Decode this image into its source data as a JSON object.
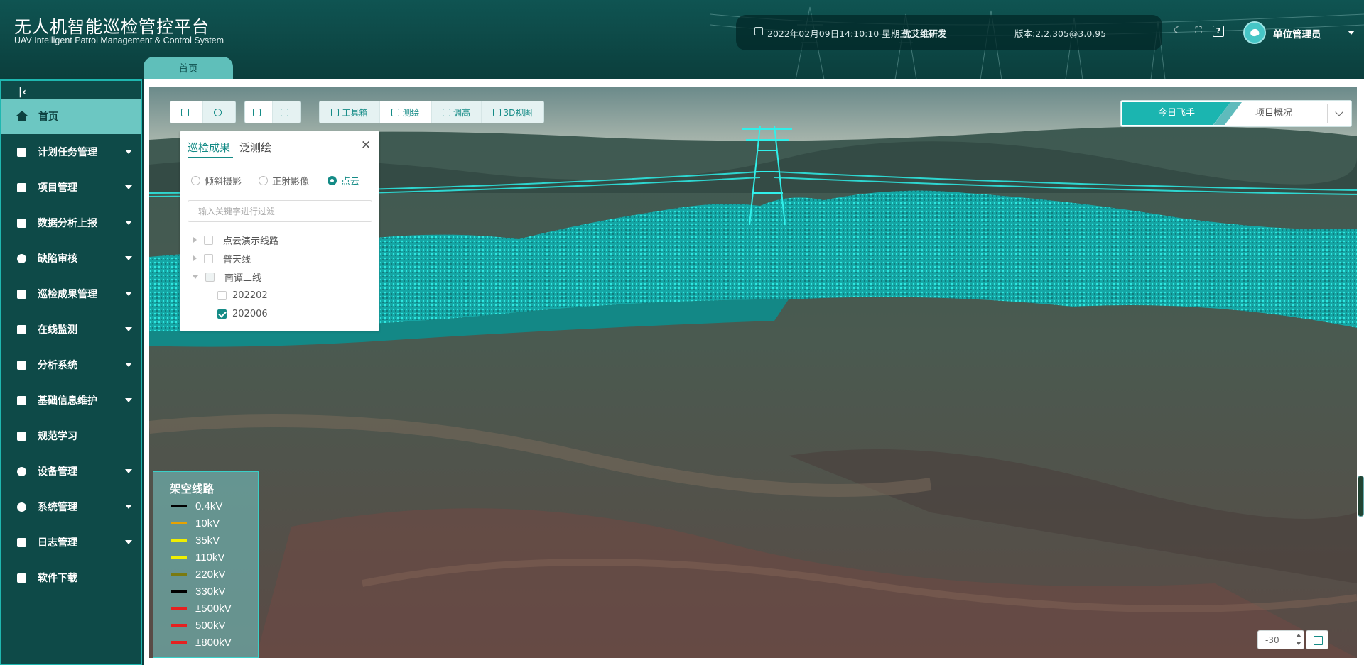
{
  "header": {
    "title": "无人机智能巡检管控平台",
    "subtitle": "UAV Intelligent Patrol Management & Control System",
    "datetime": "2022年02月09日14:10:10 星期三",
    "developer": "优艾维研发",
    "version": "版本:2.2.305@3.0.95",
    "user_name": "单位管理员",
    "icons": [
      "calendar-icon",
      "moon-icon",
      "fullscreen-icon",
      "help-icon"
    ]
  },
  "tabs": [
    {
      "label": "首页"
    }
  ],
  "sidebar": {
    "items": [
      {
        "label": "首页",
        "icon": "home-icon",
        "active": true
      },
      {
        "label": "计划任务管理",
        "icon": "task-icon",
        "expandable": true
      },
      {
        "label": "项目管理",
        "icon": "project-icon",
        "expandable": true
      },
      {
        "label": "数据分析上报",
        "icon": "report-icon",
        "expandable": true
      },
      {
        "label": "缺陷审核",
        "icon": "user-icon",
        "expandable": true
      },
      {
        "label": "巡检成果管理",
        "icon": "folder-icon",
        "expandable": true
      },
      {
        "label": "在线监测",
        "icon": "monitor-icon",
        "expandable": true
      },
      {
        "label": "分析系统",
        "icon": "analysis-icon",
        "expandable": true
      },
      {
        "label": "基础信息维护",
        "icon": "layers-icon",
        "expandable": true
      },
      {
        "label": "规范学习",
        "icon": "book-icon",
        "expandable": false
      },
      {
        "label": "设备管理",
        "icon": "drone-icon",
        "expandable": true
      },
      {
        "label": "系统管理",
        "icon": "settings-user-icon",
        "expandable": true
      },
      {
        "label": "日志管理",
        "icon": "log-icon",
        "expandable": true
      },
      {
        "label": "软件下载",
        "icon": "download-icon",
        "expandable": false
      }
    ]
  },
  "toolbar": {
    "toolbox": "工具箱",
    "measure": "测绘",
    "adjust_height": "调高",
    "view3d": "3D视图"
  },
  "right_tabs": {
    "active": "今日飞手",
    "inactive": "项目概况"
  },
  "panel": {
    "tab1": "巡检成果",
    "tab2": "泛测绘",
    "radios": [
      {
        "label": "倾斜摄影",
        "checked": false
      },
      {
        "label": "正射影像",
        "checked": false
      },
      {
        "label": "点云",
        "checked": true
      }
    ],
    "filter_placeholder": "输入关键字进行过滤",
    "tree": [
      {
        "label": "点云演示线路",
        "expanded": false,
        "checked": false
      },
      {
        "label": "普天线",
        "expanded": false,
        "checked": false
      },
      {
        "label": "南谭二线",
        "expanded": true,
        "checked": false
      },
      {
        "label": "202202",
        "checked": false
      },
      {
        "label": "202006",
        "checked": true
      }
    ]
  },
  "legend": {
    "title": "架空线路",
    "items": [
      {
        "label": "0.4kV",
        "color": "#000000"
      },
      {
        "label": "10kV",
        "color": "#e8a200"
      },
      {
        "label": "35kV",
        "color": "#f0ee00"
      },
      {
        "label": "110kV",
        "color": "#f0f000"
      },
      {
        "label": "220kV",
        "color": "#7a7a10"
      },
      {
        "label": "330kV",
        "color": "#000000"
      },
      {
        "label": "±500kV",
        "color": "#e62020"
      },
      {
        "label": "500kV",
        "color": "#e62020"
      },
      {
        "label": "±800kV",
        "color": "#e62020"
      }
    ]
  },
  "bottom": {
    "value": "-30"
  }
}
